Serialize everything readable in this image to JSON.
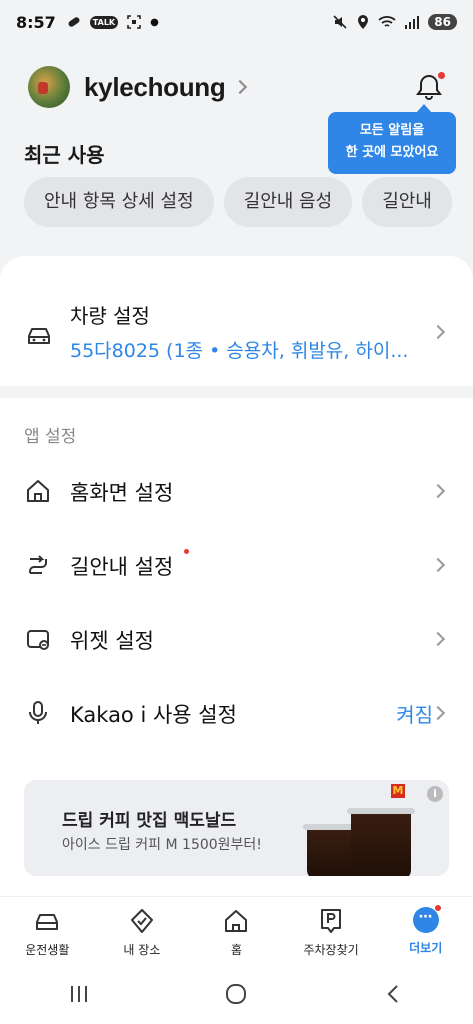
{
  "status_bar": {
    "time": "8:57",
    "left_badges": [
      "TALK"
    ],
    "battery": "86"
  },
  "profile": {
    "username": "kylechoung"
  },
  "tooltip": {
    "line1": "모든 알림을",
    "line2": "한 곳에 모았어요"
  },
  "recent": {
    "title": "최근 사용",
    "chips": [
      "안내 항목 상세 설정",
      "길안내 음성",
      "길안내"
    ]
  },
  "vehicle": {
    "title": "차량 설정",
    "subtitle": "55다8025 (1종 • 승용차, 휘발유, 하이..."
  },
  "app_settings": {
    "section_label": "앱 설정",
    "items": [
      {
        "label": "홈화면 설정",
        "icon": "home-icon"
      },
      {
        "label": "길안내 설정",
        "icon": "route-icon",
        "new_dot": true
      },
      {
        "label": "위젯 설정",
        "icon": "widget-icon"
      },
      {
        "label": "Kakao i 사용 설정",
        "icon": "mic-icon",
        "value": "켜짐"
      }
    ]
  },
  "ad": {
    "title": "드립 커피 맛집 맥도날드",
    "subtitle": "아이스 드립 커피 M 1500원부터!",
    "info": "i",
    "brand_mark": "M"
  },
  "bottom_nav": {
    "items": [
      {
        "label": "운전생활",
        "icon": "car-icon"
      },
      {
        "label": "내 장소",
        "icon": "shield-check-icon"
      },
      {
        "label": "홈",
        "icon": "home-icon"
      },
      {
        "label": "주차장찾기",
        "icon": "parking-icon"
      },
      {
        "label": "더보기",
        "icon": "more-icon",
        "active": true
      }
    ]
  },
  "colors": {
    "accent": "#2f86e6",
    "alert": "#e53935"
  }
}
